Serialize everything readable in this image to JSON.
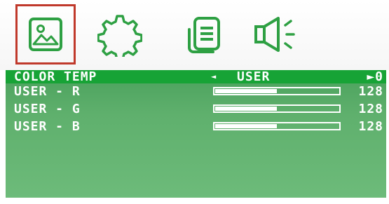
{
  "icons": [
    {
      "name": "picture-icon",
      "selected": true
    },
    {
      "name": "gear-icon",
      "selected": false
    },
    {
      "name": "document-icon",
      "selected": false
    },
    {
      "name": "speaker-icon",
      "selected": false
    }
  ],
  "menu": {
    "color_temp": {
      "label": "COLOR TEMP",
      "left_arrow": "◄",
      "value": "USER",
      "right_arrow_value": "►0"
    },
    "rows": [
      {
        "label": "USER - R",
        "value": "128",
        "level": 0.5
      },
      {
        "label": "USER - G",
        "value": "128",
        "level": 0.5
      },
      {
        "label": "USER - B",
        "value": "128",
        "level": 0.5
      }
    ]
  },
  "colors": {
    "accent": "#2ea043",
    "highlight_row": "#17a336",
    "selected_border": "#c0392b",
    "panel": "#5fb06d"
  }
}
